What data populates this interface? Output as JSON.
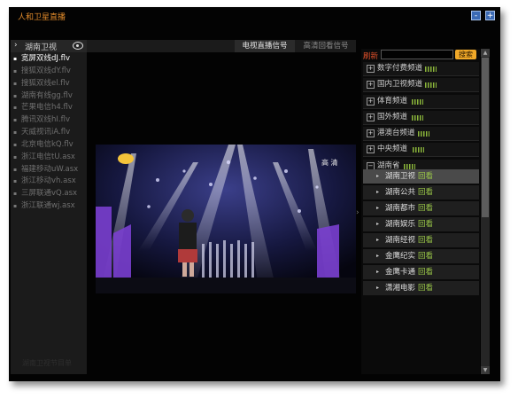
{
  "window": {
    "title": "人和卫星直播",
    "min_label": "-",
    "max_label": "+"
  },
  "left_panel": {
    "header_label": "湖南卫视",
    "header_arrow": "›",
    "streams": [
      "宽屏双线dJ.flv",
      "搜狐双线dY.flv",
      "搜狐双线el.flv",
      "湖南有线gg.flv",
      "芒果电信h4.flv",
      "腾讯双线hI.flv",
      "天威视讯iA.flv",
      "北京电信kQ.flv",
      "浙江电信tU.asx",
      "福建移动uW.asx",
      "浙江移动vh.asx",
      "三屏联通vQ.asx",
      "浙江联通wj.asx"
    ],
    "selected_index": 0,
    "bullet": "▪",
    "footer": "湖南卫视节目单"
  },
  "tabs": {
    "live": "电视直播信号",
    "replay": "高清回看信号"
  },
  "video": {
    "overlay_logo": "高 清"
  },
  "collapse_arrow": "›",
  "right_panel": {
    "refresh": "刷新",
    "search_placeholder": "",
    "search_button": "搜索",
    "categories": [
      {
        "sign": "+",
        "name": "数字付费频道"
      },
      {
        "sign": "+",
        "name": "国内卫视频道"
      },
      {
        "sign": "+",
        "name": "体育频道"
      },
      {
        "sign": "+",
        "name": "国外频道"
      },
      {
        "sign": "+",
        "name": "港澳台频道"
      },
      {
        "sign": "+",
        "name": "中央频道"
      },
      {
        "sign": "−",
        "name": "湖南省"
      }
    ],
    "sub_channels": [
      {
        "name": "湖南卫视",
        "watch": "回看"
      },
      {
        "name": "湖南公共",
        "watch": "回看"
      },
      {
        "name": "湖南都市",
        "watch": "回看"
      },
      {
        "name": "湖南娱乐",
        "watch": "回看"
      },
      {
        "name": "湖南经视",
        "watch": "回看"
      },
      {
        "name": "金鹰纪实",
        "watch": "回看"
      },
      {
        "name": "金鹰卡通",
        "watch": "回看"
      },
      {
        "name": "潇湘电影",
        "watch": "回看"
      }
    ],
    "selected_sub": 0,
    "sub_arrow": "▸"
  },
  "scrollbar": {
    "up": "▲",
    "down": "▼"
  },
  "colors": {
    "background": "#030303",
    "accent_orange": "#f0a828",
    "watch_green": "#9bc848",
    "title_orange": "#e08a2a",
    "refresh_red": "#e0502a"
  }
}
